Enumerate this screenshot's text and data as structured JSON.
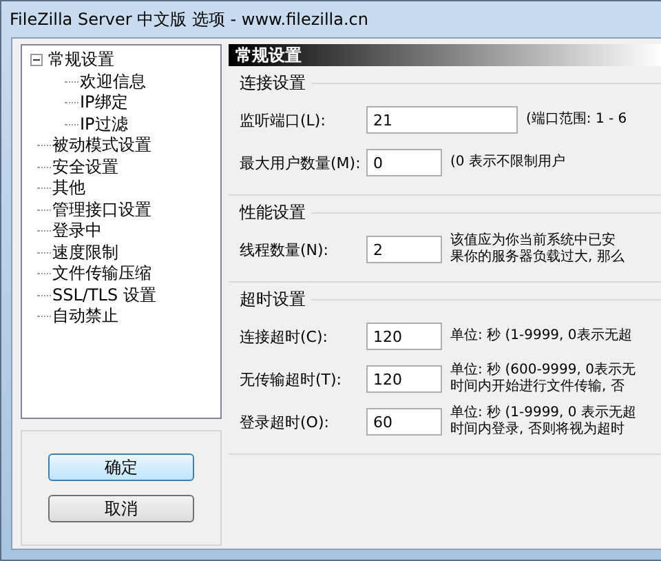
{
  "window": {
    "title": "FileZilla Server 中文版 选项 - www.filezilla.cn"
  },
  "tree": [
    {
      "label": "常规设置",
      "expanded": true,
      "children": [
        {
          "label": "欢迎信息"
        },
        {
          "label": "IP绑定"
        },
        {
          "label": "IP过滤"
        }
      ]
    },
    {
      "label": "被动模式设置"
    },
    {
      "label": "安全设置"
    },
    {
      "label": "其他"
    },
    {
      "label": "管理接口设置"
    },
    {
      "label": "登录中"
    },
    {
      "label": "速度限制"
    },
    {
      "label": "文件传输压缩"
    },
    {
      "label": "SSL/TLS 设置"
    },
    {
      "label": "自动禁止"
    }
  ],
  "buttons": [
    "确定",
    "取消"
  ],
  "page": {
    "title": "常规设置",
    "groups": [
      {
        "title": "连接设置",
        "rows": [
          {
            "label": "监听端口(L):",
            "value": "21",
            "kind": "wide",
            "note": [
              "(端口范围: 1 - 6"
            ]
          },
          {
            "label": "最大用户数量(M):",
            "value": "0",
            "kind": "narrow",
            "note": [
              "(0 表示不限制用户"
            ]
          }
        ]
      },
      {
        "title": "性能设置",
        "rows": [
          {
            "label": "线程数量(N):",
            "value": "2",
            "kind": "narrow",
            "note": [
              "该值应为你当前系统中已安",
              "果你的服务器负载过大, 那么"
            ]
          }
        ]
      },
      {
        "title": "超时设置",
        "rows": [
          {
            "label": "连接超时(C):",
            "value": "120",
            "kind": "narrow",
            "note": [
              "单位: 秒 (1-9999, 0表示无超"
            ]
          },
          {
            "label": "无传输超时(T):",
            "value": "120",
            "kind": "narrow",
            "note": [
              "单位: 秒 (600-9999, 0表示无",
              "时间内开始进行文件传输, 否"
            ]
          },
          {
            "label": "登录超时(O):",
            "value": "60",
            "kind": "narrow",
            "note": [
              "单位: 秒 (1-9999, 0 表示无超",
              "时间内登录, 否则将视为超时"
            ]
          }
        ]
      }
    ]
  }
}
